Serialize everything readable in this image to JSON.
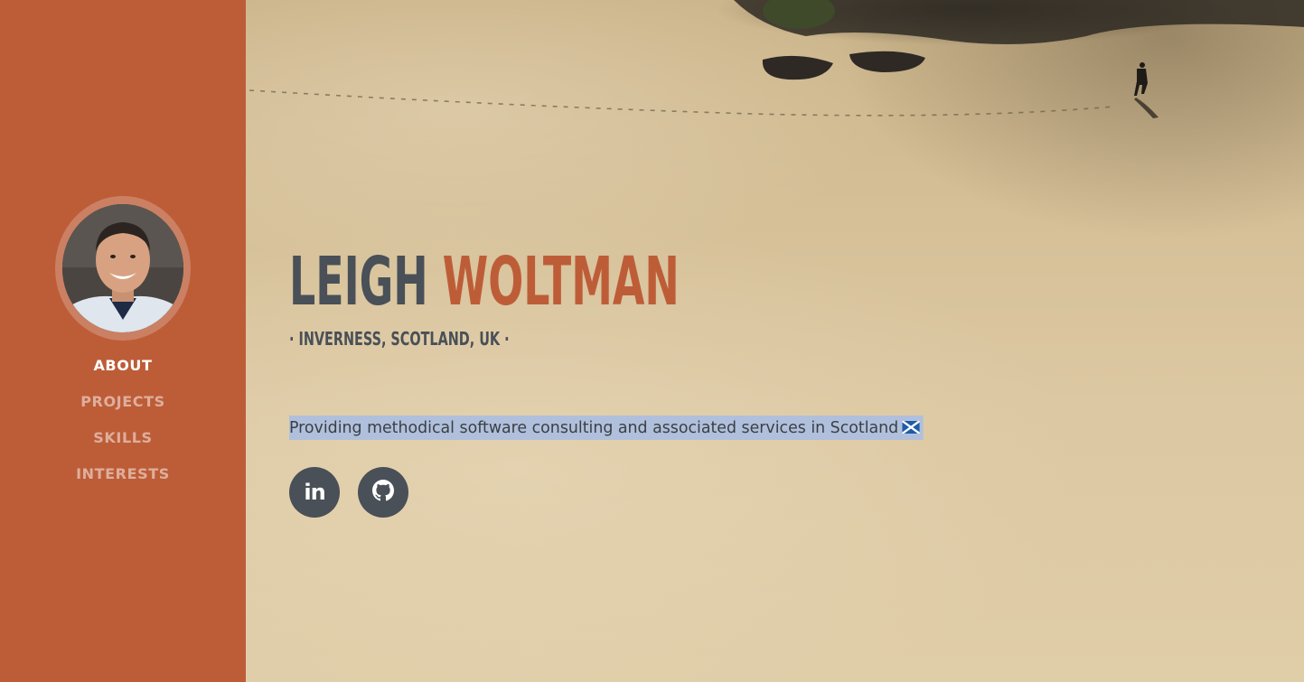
{
  "profile": {
    "first_name": "LEIGH",
    "last_name": "WOLTMAN",
    "location": "· INVERNESS, SCOTLAND, UK ·",
    "tagline": "Providing methodical software consulting and associated services in Scotland",
    "flag_icon": "scotland-flag-icon"
  },
  "sidebar": {
    "avatar_icon": "profile-photo",
    "items": [
      {
        "label": "ABOUT",
        "active": true
      },
      {
        "label": "PROJECTS",
        "active": false
      },
      {
        "label": "SKILLS",
        "active": false
      },
      {
        "label": "INTERESTS",
        "active": false
      }
    ]
  },
  "social": {
    "linkedin_label": "in",
    "linkedin_icon": "linkedin-icon",
    "github_icon": "github-icon"
  },
  "colors": {
    "sidebar": "#bd5d38",
    "accent": "#bd5d38",
    "text_dark": "#495057",
    "selection": "#b0c0dc"
  }
}
